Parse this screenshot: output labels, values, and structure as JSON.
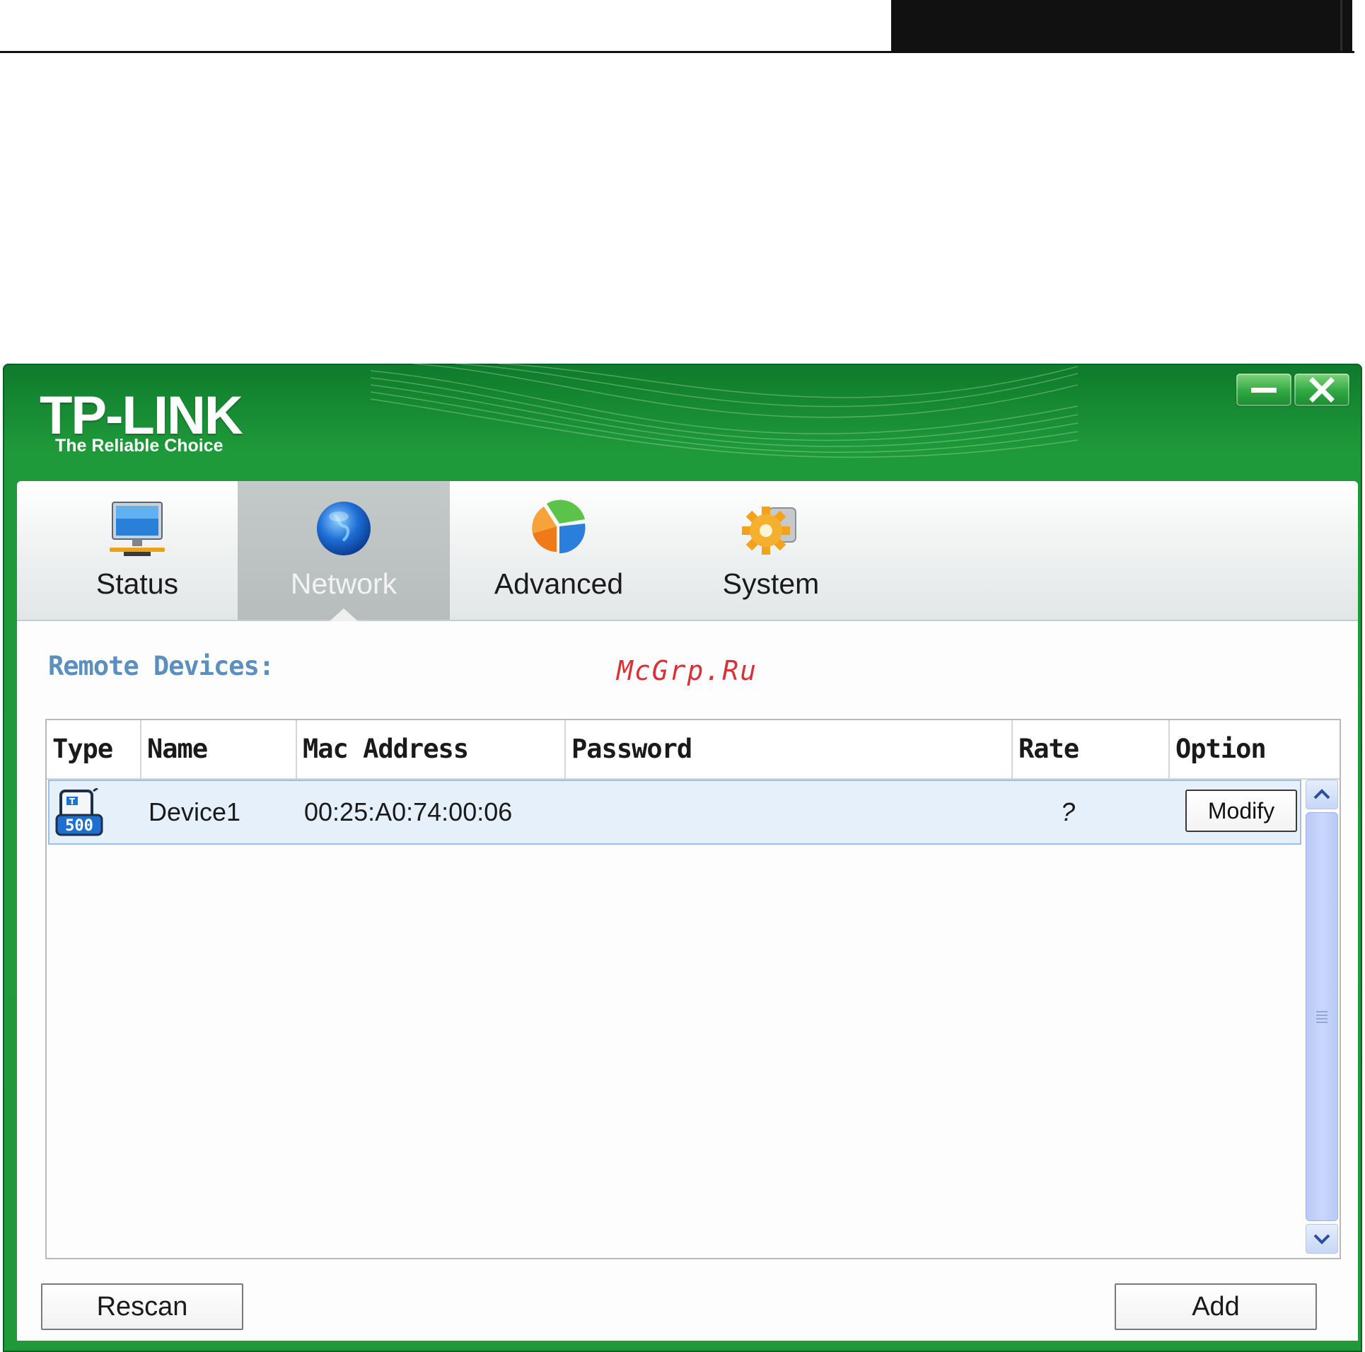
{
  "app": {
    "brand": "TP-LINK",
    "tagline": "The Reliable Choice",
    "colors": {
      "frame": "#20993b",
      "section_title": "#5b8fbf",
      "row_highlight": "#e6f0fb",
      "watermark": "#d83236"
    }
  },
  "window_controls": {
    "minimize_icon": "minimize-icon",
    "close_icon": "close-icon"
  },
  "tabs": [
    {
      "label": "Status",
      "icon": "monitor-icon",
      "active": false
    },
    {
      "label": "Network",
      "icon": "globe-icon",
      "active": true
    },
    {
      "label": "Advanced",
      "icon": "pie-chart-icon",
      "active": false
    },
    {
      "label": "System",
      "icon": "gear-icon",
      "active": false
    }
  ],
  "section": {
    "title": "Remote Devices:"
  },
  "watermark": "McGrp.Ru",
  "table": {
    "columns": [
      "Type",
      "Name",
      "Mac Address",
      "Password",
      "Rate",
      "Option"
    ],
    "rows": [
      {
        "type_icon": "powerline-adapter-icon",
        "type_badge": "500",
        "name": "Device1",
        "mac": "00:25:A0:74:00:06",
        "password": "",
        "rate": "?",
        "option": "Modify"
      }
    ]
  },
  "scrollbar": {
    "up_icon": "chevron-up-icon",
    "down_icon": "chevron-down-icon"
  },
  "footer": {
    "rescan_label": "Rescan",
    "add_label": "Add"
  }
}
